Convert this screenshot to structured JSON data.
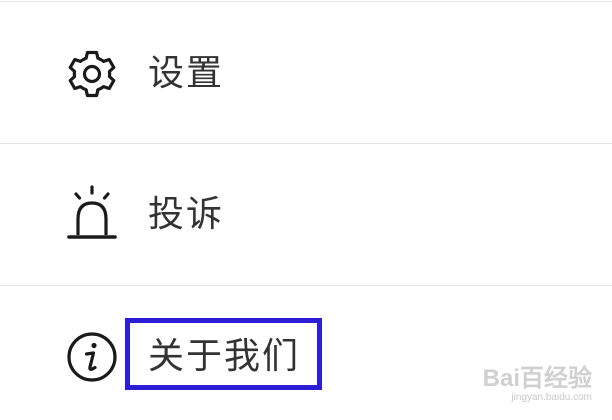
{
  "menu": {
    "items": [
      {
        "label": "设置",
        "icon": "gear-icon"
      },
      {
        "label": "投诉",
        "icon": "alarm-siren-icon"
      },
      {
        "label": "关于我们",
        "icon": "info-icon"
      }
    ],
    "highlight_color": "#2b1ed6"
  },
  "watermark": {
    "logo": "Bai百经验",
    "url": "jingyan.baidu.com"
  }
}
